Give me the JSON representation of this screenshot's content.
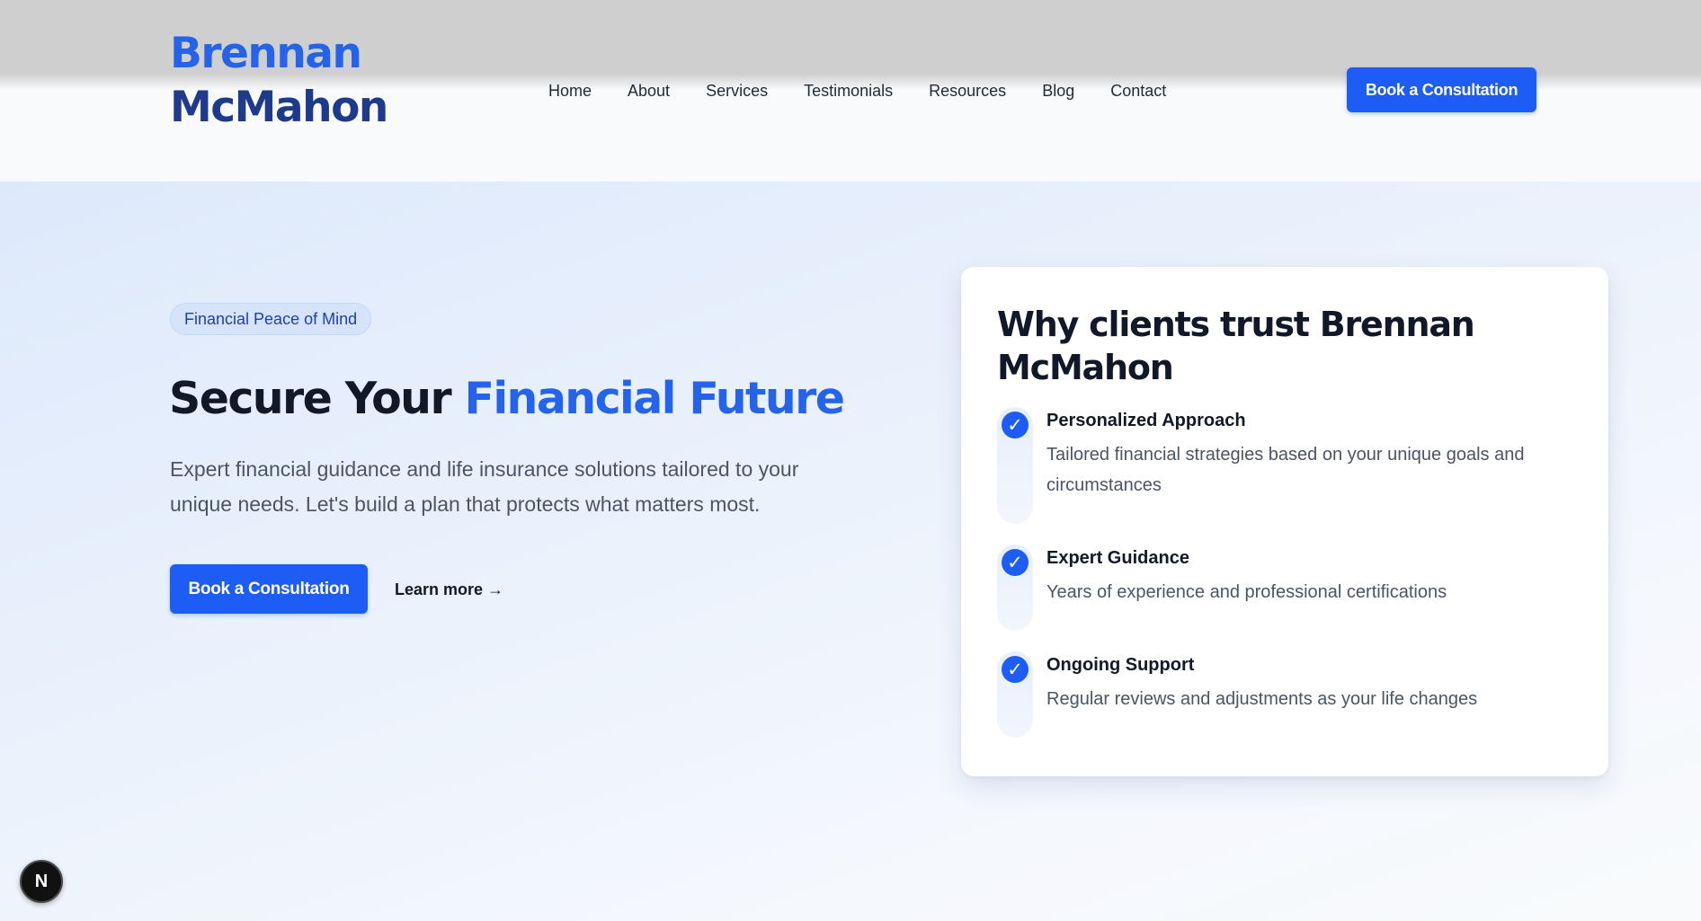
{
  "header": {
    "logo_first": "Brennan",
    "logo_last": "McMahon",
    "nav": [
      "Home",
      "About",
      "Services",
      "Testimonials",
      "Resources",
      "Blog",
      "Contact"
    ],
    "cta_label": "Book a Consultation"
  },
  "hero": {
    "badge": "Financial Peace of Mind",
    "title_plain": "Secure Your ",
    "title_accent": "Financial Future",
    "description": "Expert financial guidance and life insurance solutions tailored to your unique needs. Let's build a plan that protects what matters most.",
    "primary_cta": "Book a Consultation",
    "secondary_cta": "Learn more →"
  },
  "trust_card": {
    "title": "Why clients trust Brennan McMahon",
    "items": [
      {
        "title": "Personalized Approach",
        "description": "Tailored financial strategies based on your unique goals and circumstances"
      },
      {
        "title": "Expert Guidance",
        "description": "Years of experience and professional certifications"
      },
      {
        "title": "Ongoing Support",
        "description": "Regular reviews and adjustments as your life changes"
      }
    ]
  },
  "dev_indicator": {
    "label": "N"
  },
  "icons": {
    "check": "check-icon"
  },
  "colors": {
    "primary": "#1d5cf5",
    "brand_blue": "#2563eb",
    "brand_navy": "#1e3a8a",
    "text_dark": "#111827",
    "text_muted": "#4b5563"
  }
}
